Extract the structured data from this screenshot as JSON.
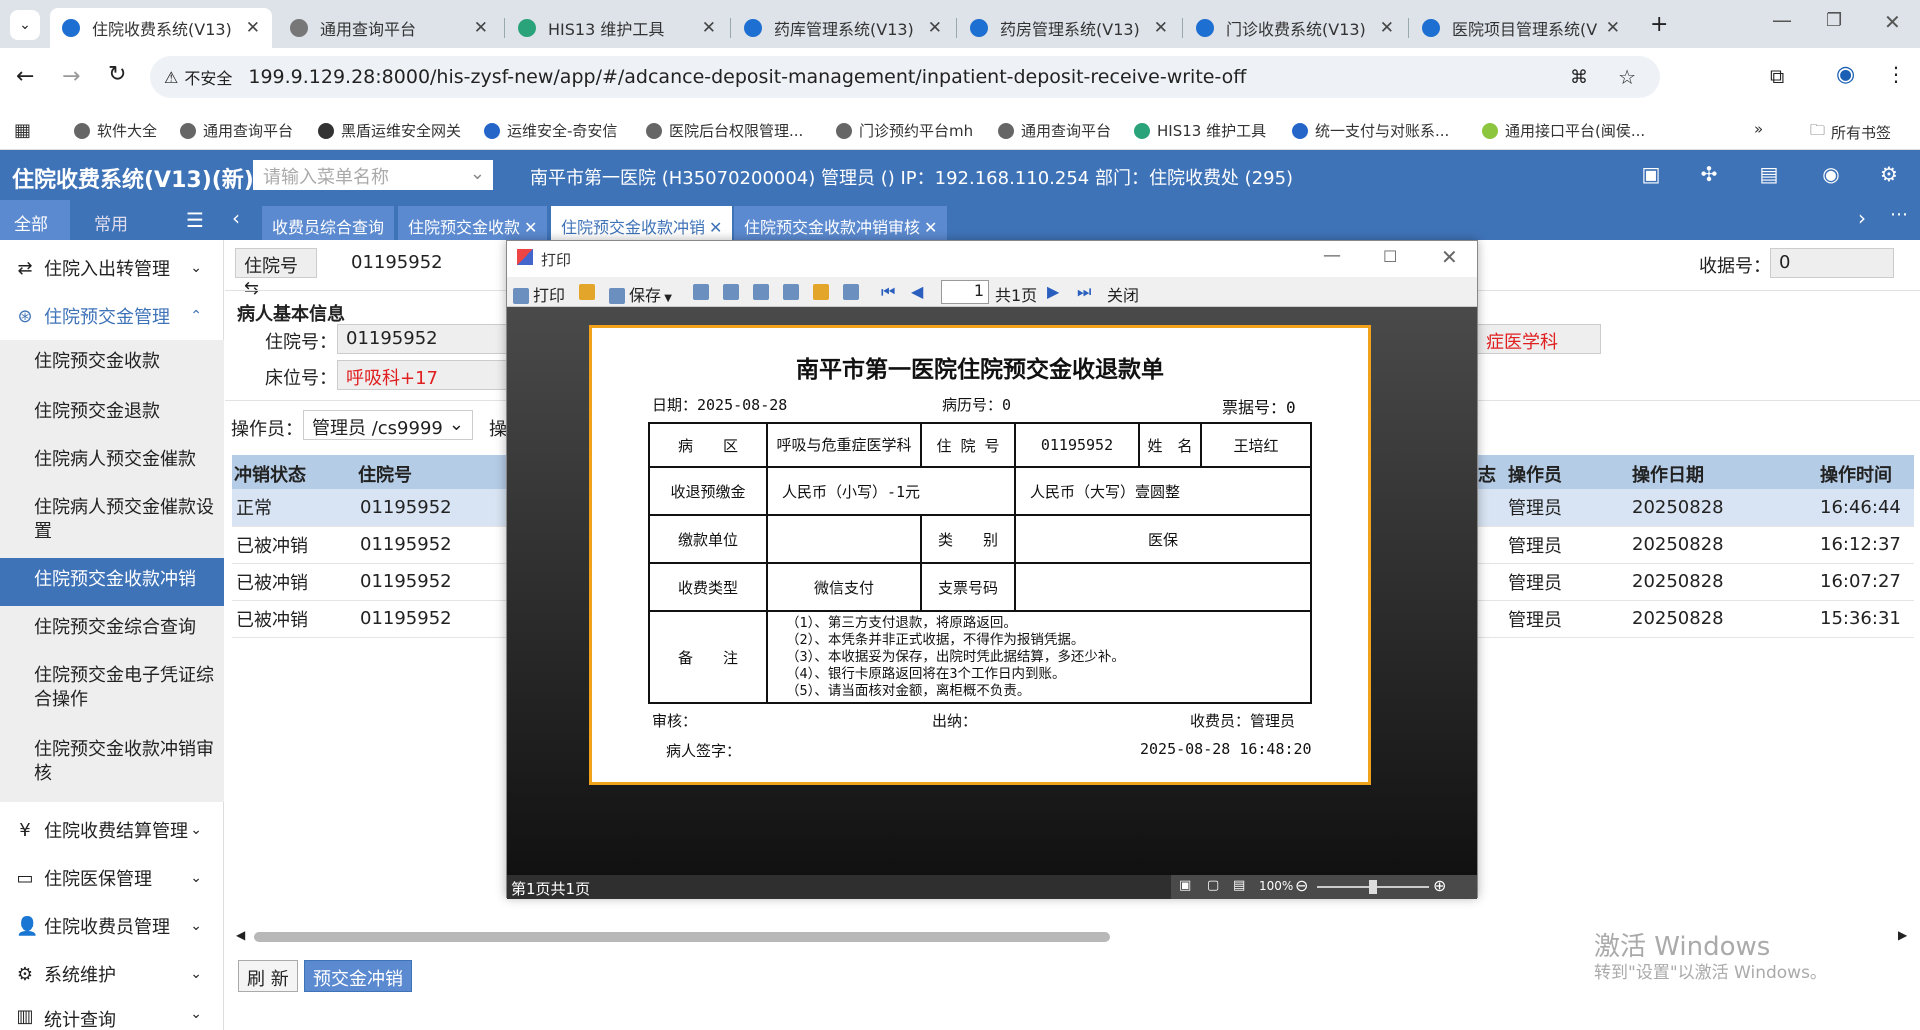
{
  "browser": {
    "tabs": [
      {
        "label": "住院收费系统(V13)"
      },
      {
        "label": "通用查询平台"
      },
      {
        "label": "HIS13 维护工具"
      },
      {
        "label": "药库管理系统(V13)"
      },
      {
        "label": "药房管理系统(V13)"
      },
      {
        "label": "门诊收费系统(V13)"
      },
      {
        "label": "医院项目管理系统(V"
      }
    ],
    "security": "不安全",
    "url": "199.9.129.28:8000/his-zysf-new/app/#/adcance-deposit-management/inpatient-deposit-receive-write-off",
    "bookmarks": [
      "软件大全",
      "通用查询平台",
      "黑盾运维安全网关",
      "运维安全-奇安信",
      "医院后台权限管理...",
      "门诊预约平台mh",
      "通用查询平台",
      "HIS13 维护工具",
      "统一支付与对账系...",
      "通用接口平台(闽侯..."
    ],
    "all_bookmarks": "所有书签"
  },
  "app": {
    "title": "住院收费系统(V13)(新)",
    "menu_search_placeholder": "请输入菜单名称",
    "info": "南平市第一医院 (H35070200004) 管理员 () IP：192.168.110.254 部门：住院收费处 (295)",
    "menu_tabs": [
      "全部",
      "常用"
    ],
    "open_tabs": [
      "收费员综合查询",
      "住院预交金收款",
      "住院预交金收款冲销",
      "住院预交金收款冲销审核"
    ]
  },
  "sidebar": {
    "groups": [
      {
        "label": "住院入出转管理"
      },
      {
        "label": "住院预交金管理"
      },
      {
        "label": "住院收费结算管理"
      },
      {
        "label": "住院医保管理"
      },
      {
        "label": "住院收费员管理"
      },
      {
        "label": "系统维护"
      },
      {
        "label": "统计查询"
      }
    ],
    "items": [
      "住院预交金收款",
      "住院预交金退款",
      "住院病人预交金催款",
      "住院病人预交金催款设置",
      "住院预交金收款冲销",
      "住院预交金综合查询",
      "住院预交金电子凭证综合操作",
      "住院预交金收款冲销审核"
    ]
  },
  "form": {
    "query_type": "住院号",
    "query_value": "01195952",
    "receipt_label": "收据号：",
    "receipt_value": "0",
    "section": "病人基本信息",
    "inpatient_label": "住院号：",
    "inpatient_value": "01195952",
    "bed_label": "床位号：",
    "bed_value": "呼吸科+17",
    "dept_partial": "症医学科",
    "operator_label": "操作员：",
    "operator_value": "管理员 /cs9999",
    "operator_next": "操"
  },
  "grid": {
    "headers_left": [
      "冲销状态",
      "住院号"
    ],
    "headers_right": [
      "志",
      "操作员",
      "操作日期",
      "操作时间"
    ],
    "rows": [
      {
        "status": "正常",
        "no": "01195952",
        "op": "管理员",
        "date": "20250828",
        "time": "16:46:44"
      },
      {
        "status": "已被冲销",
        "no": "01195952",
        "op": "管理员",
        "date": "20250828",
        "time": "16:12:37"
      },
      {
        "status": "已被冲销",
        "no": "01195952",
        "op": "管理员",
        "date": "20250828",
        "time": "16:07:27"
      },
      {
        "status": "已被冲销",
        "no": "01195952",
        "op": "管理员",
        "date": "20250828",
        "time": "15:36:31"
      }
    ]
  },
  "buttons": {
    "refresh": "刷 新",
    "writeoff": "预交金冲销"
  },
  "dialog": {
    "title": "打印",
    "toolbar": {
      "print": "打印",
      "save": "保存",
      "page": "1",
      "pages": "共1页",
      "close": "关闭"
    },
    "status": "第1页共1页",
    "zoom": "100%"
  },
  "receipt": {
    "title": "南平市第一医院住院预交金收退款单",
    "date": "日期：2025-08-28",
    "record_no": "病历号：0",
    "bill_no": "票据号：0",
    "ward_label": "病　　区",
    "ward_value": "呼吸与危重症医学科",
    "inp_label": "住 院 号",
    "inp_value": "01195952",
    "name_label": "姓　名",
    "name_value": "王培红",
    "amount_label": "收退预缴金",
    "amount_small": "人民币（小写）-1元",
    "amount_big": "人民币（大写）壹圆整",
    "unit_label": "缴款单位",
    "unit_value": "",
    "category_label": "类　　别",
    "category_value": "医保",
    "paytype_label": "收费类型",
    "paytype_value": "微信支付",
    "check_label": "支票号码",
    "check_value": "",
    "notes_label": "备　　注",
    "notes": [
      "（1）、第三方支付退款，将原路返回。",
      "（2）、本凭条并非正式收据，不得作为报销凭据。",
      "（3）、本收据妥为保存，出院时凭此据结算，多还少补。",
      "（4）、银行卡原路返回将在3个工作日内到账。",
      "（5）、请当面核对金额，离柜概不负责。"
    ],
    "auditor": "审核：",
    "cashier": "出纳：",
    "collector": "收费员：管理员",
    "sign": "病人签字：",
    "datetime": "2025-08-28  16:48:20"
  },
  "watermark": {
    "line1": "激活 Windows",
    "line2": "转到\"设置\"以激活 Windows。"
  }
}
